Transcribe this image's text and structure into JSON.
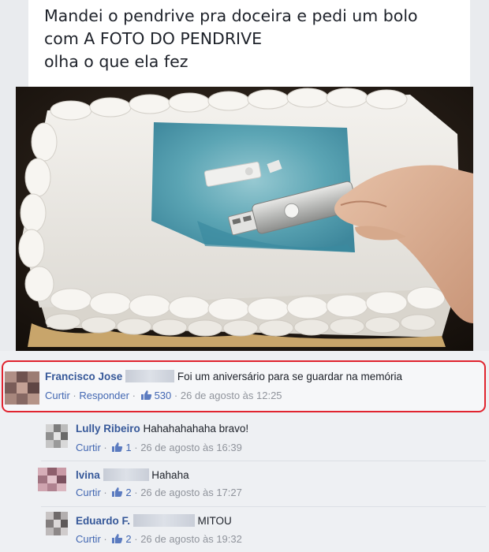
{
  "post": {
    "line1": "Mandei o pendrive pra doceira e pedi um bolo",
    "line2": "com A FOTO DO PENDRIVE",
    "line3": "olha o que ela fez"
  },
  "colors": {
    "link": "#365899",
    "action": "#4267b2",
    "highlight_border": "#e0242f"
  },
  "comments": [
    {
      "author": "Francisco Jose",
      "text": "Foi um aniversário para se guardar na memória",
      "like_label": "Curtir",
      "reply_label": "Responder",
      "likes": "530",
      "time": "26 de agosto às 12:25"
    },
    {
      "author": "Lully Ribeiro",
      "text": "Hahahahahaha bravo!",
      "like_label": "Curtir",
      "likes": "1",
      "time": "26 de agosto às 16:39"
    },
    {
      "author": "lvina",
      "text": "Hahaha",
      "like_label": "Curtir",
      "likes": "2",
      "time": "26 de agosto às 17:27"
    },
    {
      "author": "Eduardo F.",
      "text": "MITOU",
      "like_label": "Curtir",
      "likes": "2",
      "time": "26 de agosto às 19:32"
    }
  ],
  "separator": "·",
  "icons": {
    "like": "thumbs-up-icon"
  }
}
